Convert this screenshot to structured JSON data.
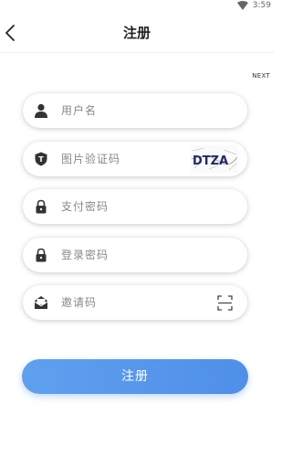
{
  "status_bar": {
    "time": "3:59",
    "wifi_icon": "wifi-icon"
  },
  "header": {
    "title": "注册",
    "back_icon": "chevron-left-icon"
  },
  "next_label": "NEXT",
  "form": {
    "username": {
      "placeholder": "用户名",
      "icon": "user-icon"
    },
    "captcha": {
      "placeholder": "图片验证码",
      "icon": "shield-icon",
      "captcha_text": "DTZA"
    },
    "pay_password": {
      "placeholder": "支付密码",
      "icon": "lock-icon"
    },
    "login_password": {
      "placeholder": "登录密码",
      "icon": "lock-icon"
    },
    "invite_code": {
      "placeholder": "邀请码",
      "icon": "envelope-icon",
      "scan_icon": "scan-icon"
    }
  },
  "submit_label": "注册",
  "colors": {
    "accent": "#4f8fe8",
    "icon": "#333333",
    "placeholder": "#888888"
  }
}
